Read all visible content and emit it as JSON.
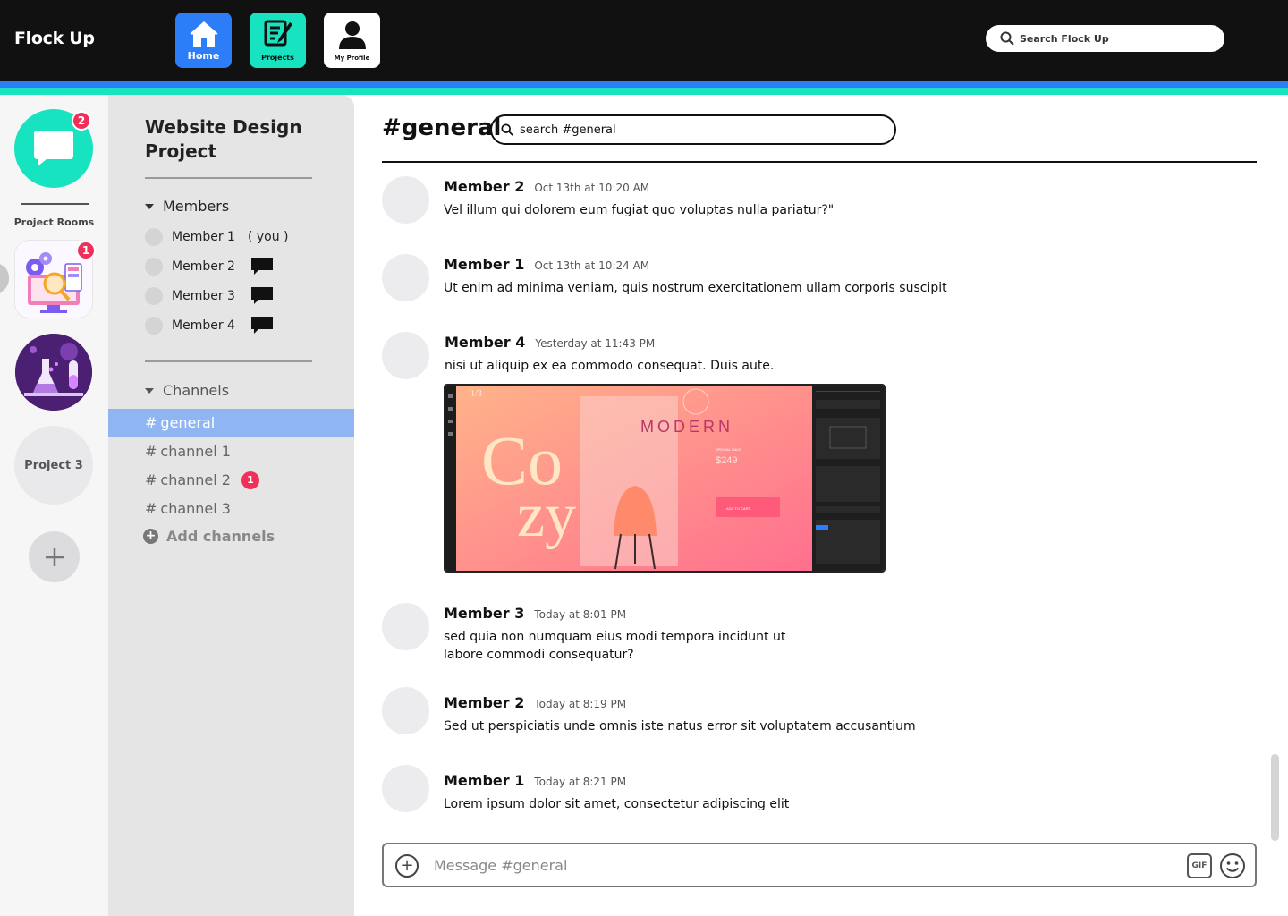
{
  "app": {
    "brand": "Flock Up"
  },
  "topnav": {
    "items": [
      {
        "label": "Home",
        "icon": "home-icon",
        "color": "#2c7ef8"
      },
      {
        "label": "Projects",
        "icon": "projects-icon",
        "color": "#18e3c0"
      },
      {
        "label": "My Profile",
        "icon": "profile-icon",
        "color": "#ffffff"
      }
    ],
    "search_placeholder": "Search Flock Up"
  },
  "rail": {
    "chat_badge": "2",
    "label": "Project Rooms",
    "project1_badge": "1",
    "project3_label": "Project 3"
  },
  "sidebar": {
    "project_title": "Website Design Project",
    "members_header": "Members",
    "members": [
      {
        "name": "Member 1",
        "note": "( you )"
      },
      {
        "name": "Member 2"
      },
      {
        "name": "Member 3"
      },
      {
        "name": "Member 4"
      }
    ],
    "channels_header": "Channels",
    "channels": [
      {
        "hash": "#",
        "name": "general",
        "active": true
      },
      {
        "hash": "#",
        "name": "channel 1"
      },
      {
        "hash": "#",
        "name": "channel 2",
        "badge": "1"
      },
      {
        "hash": "#",
        "name": "channel 3"
      }
    ],
    "add_channels": "Add channels"
  },
  "main": {
    "channel_title": "#general",
    "search_placeholder": "search #general",
    "messages": [
      {
        "author": "Member 2",
        "time": "Oct 13th at 10:20 AM",
        "text": "Vel illum qui dolorem eum fugiat quo voluptas nulla pariatur?\""
      },
      {
        "author": "Member 1",
        "time": "Oct 13th at 10:24 AM",
        "text": "Ut enim ad minima veniam, quis nostrum exercitationem ullam corporis suscipit"
      },
      {
        "author": "Member 4",
        "time": "Yesterday at 11:43 PM",
        "text": "nisi ut aliquip ex ea commodo consequat. Duis aute."
      },
      {
        "author": "Member 3",
        "time": "Today at 8:01 PM",
        "text": "sed quia non numquam eius modi tempora incidunt ut labore commodi consequatur?"
      },
      {
        "author": "Member 2",
        "time": "Today at 8:19 PM",
        "text": "Sed ut perspiciatis unde omnis iste natus error sit voluptatem accusantium"
      },
      {
        "author": "Member 1",
        "time": "Today at 8:21 PM",
        "text": "Lorem ipsum dolor sit amet, consectetur adipiscing elit"
      }
    ],
    "attachment": {
      "big_word_1": "Co",
      "big_word_2": "zy",
      "heading": "MODERN",
      "sale_label": "SPECIAL SALE",
      "price": "$249",
      "cta": "ADD TO CART",
      "page_indicator": "1/3"
    },
    "composer_placeholder": "Message #general",
    "gif_label": "GIF"
  }
}
